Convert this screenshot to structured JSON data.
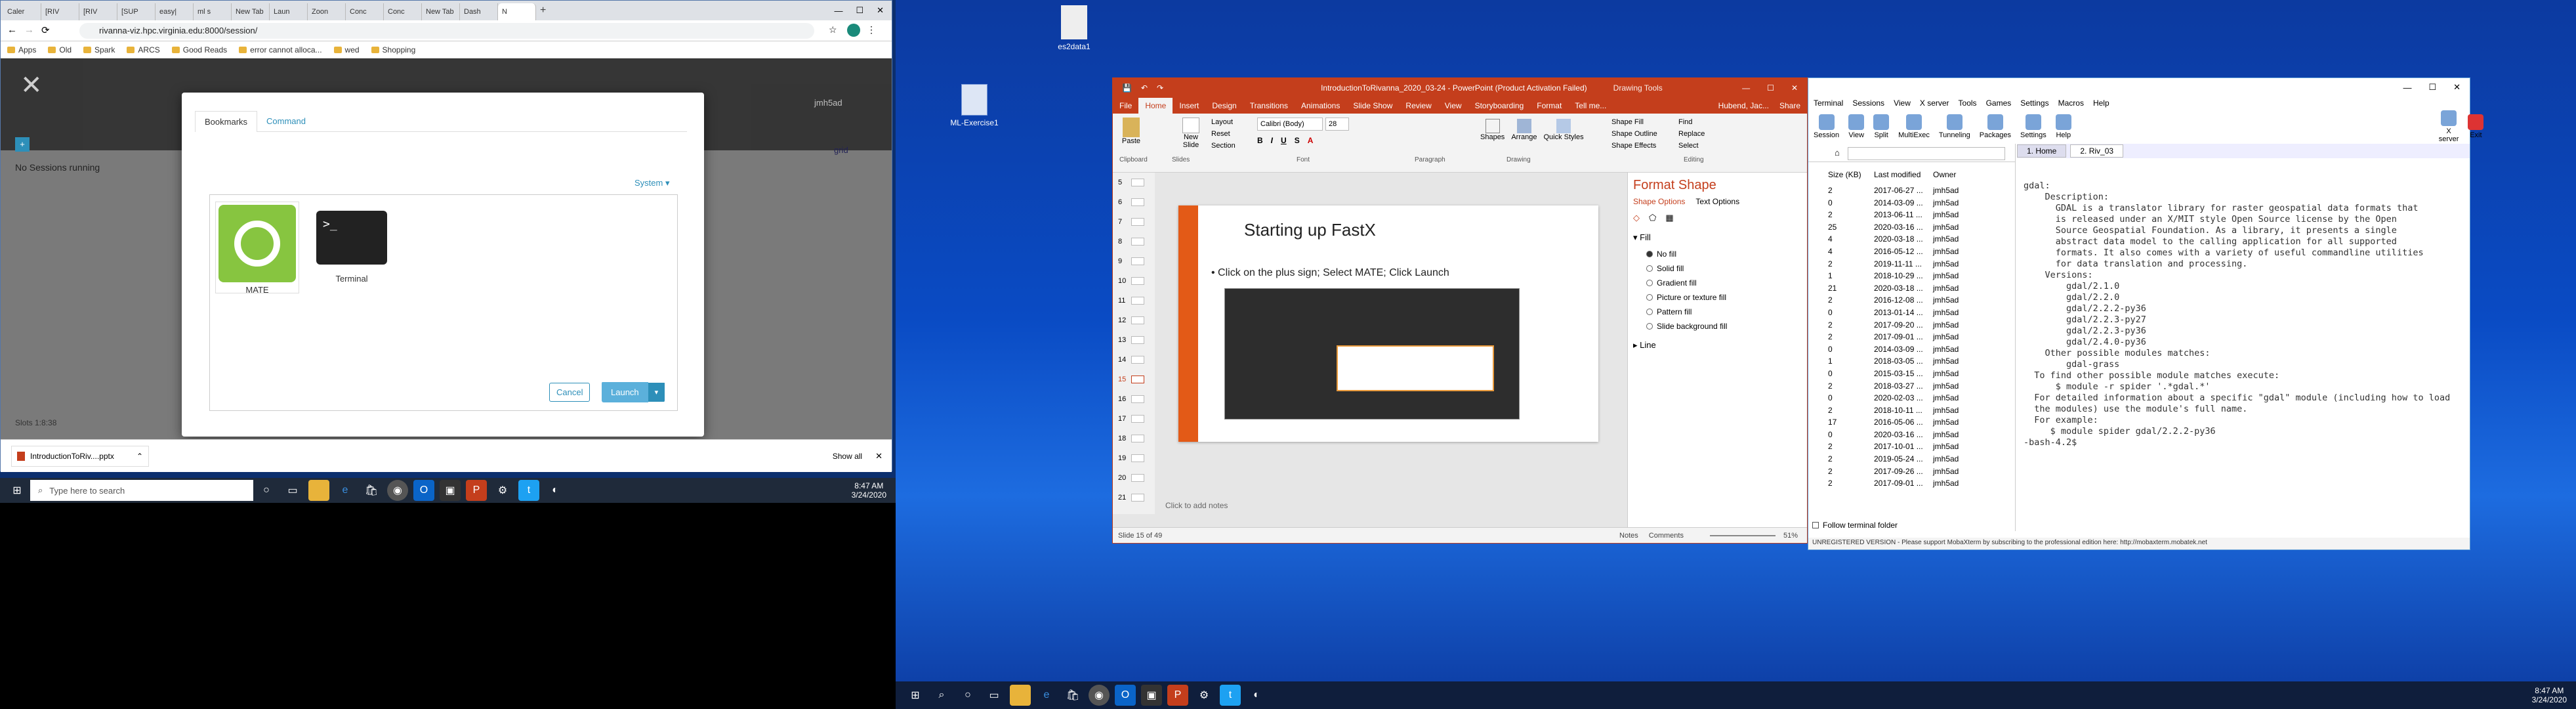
{
  "browser": {
    "tabs": [
      "Caler",
      "[RIV",
      "[RIV",
      "[SUP",
      "easy|",
      "ml s",
      "New Tab",
      "Laun",
      "Zoon",
      "Conc",
      "Conc",
      "New Tab",
      "Dash",
      "N"
    ],
    "url": "rivanna-viz.hpc.virginia.edu:8000/session/",
    "bookmarks": [
      "Apps",
      "Old",
      "Spark",
      "ARCS",
      "Good Reads",
      "error cannot alloca...",
      "wed",
      "Shopping"
    ],
    "page": {
      "user": "jmh5ad",
      "no_sessions": "No Sessions running",
      "grid": "grid",
      "footer_left": "Slots 1:8:38",
      "modal_tabs": [
        "Bookmarks",
        "Command"
      ],
      "system": "System",
      "apps": [
        {
          "label": "MATE"
        },
        {
          "label": "Terminal"
        }
      ],
      "cancel": "Cancel",
      "launch": "Launch"
    },
    "download": {
      "file": "IntroductionToRiv....pptx",
      "show_all": "Show all"
    }
  },
  "taskbar_left": {
    "search_placeholder": "Type here to search",
    "time": "8:47 AM",
    "date": "3/24/2020"
  },
  "desktop_icons": [
    "es2data1",
    "ML-Exercise1"
  ],
  "ppt": {
    "title": "IntroductionToRivanna_2020_03-24 - PowerPoint (Product Activation Failed)",
    "drawing_tools": "Drawing Tools",
    "user": "Hubend, Jac...",
    "share": "Share",
    "tell_me": "Tell me...",
    "tabs": [
      "File",
      "Home",
      "Insert",
      "Design",
      "Transitions",
      "Animations",
      "Slide Show",
      "Review",
      "View",
      "Storyboarding",
      "Format"
    ],
    "ribbon_groups": [
      "Clipboard",
      "Slides",
      "Font",
      "Paragraph",
      "Drawing",
      "Editing"
    ],
    "ribbon_labels": {
      "paste": "Paste",
      "new_slide": "New Slide",
      "layout": "Layout",
      "reset": "Reset",
      "section": "Section",
      "font": "Calibri (Body)",
      "size": "28",
      "shapes": "Shapes",
      "arrange": "Arrange",
      "quick_styles": "Quick Styles",
      "fill": "Shape Fill",
      "outline": "Shape Outline",
      "effects": "Shape Effects",
      "find": "Find",
      "replace": "Replace",
      "select": "Select"
    },
    "slide_numbers": [
      "5",
      "6",
      "7",
      "8",
      "9",
      "10",
      "11",
      "12",
      "13",
      "14",
      "15",
      "16",
      "17",
      "18",
      "19",
      "20",
      "21"
    ],
    "slide_title": "Starting up FastX",
    "bullet": "Click on the plus sign; Select MATE; Click Launch",
    "notes": "Click to add notes",
    "status_left": "Slide 15 of 49",
    "notes_btn": "Notes",
    "comments_btn": "Comments",
    "zoom": "51%",
    "format_pane": {
      "title": "Format Shape",
      "tabs": [
        "Shape Options",
        "Text Options"
      ],
      "fill": "Fill",
      "options": [
        "No fill",
        "Solid fill",
        "Gradient fill",
        "Picture or texture fill",
        "Pattern fill",
        "Slide background fill"
      ],
      "line": "Line"
    }
  },
  "moba": {
    "menu": [
      "Terminal",
      "Sessions",
      "View",
      "X server",
      "Tools",
      "Games",
      "Settings",
      "Macros",
      "Help"
    ],
    "toolbar": [
      "Session",
      "View",
      "Split",
      "MultiExec",
      "Tunneling",
      "Packages",
      "Settings",
      "Help",
      "X server",
      "Exit"
    ],
    "tabs": [
      "1. Home",
      "2. Riv_03"
    ],
    "columns": [
      "Size (KB)",
      "Last modified",
      "Owner"
    ],
    "files": [
      [
        "2",
        "2017-06-27 ...",
        "jmh5ad"
      ],
      [
        "0",
        "2014-03-09 ...",
        "jmh5ad"
      ],
      [
        "2",
        "2013-06-11 ...",
        "jmh5ad"
      ],
      [
        "25",
        "2020-03-16 ...",
        "jmh5ad"
      ],
      [
        "4",
        "2020-03-18 ...",
        "jmh5ad"
      ],
      [
        "4",
        "2016-05-12 ...",
        "jmh5ad"
      ],
      [
        "2",
        "2019-11-11 ...",
        "jmh5ad"
      ],
      [
        "1",
        "2018-10-29 ...",
        "jmh5ad"
      ],
      [
        "21",
        "2020-03-18 ...",
        "jmh5ad"
      ],
      [
        "2",
        "2016-12-08 ...",
        "jmh5ad"
      ],
      [
        "0",
        "2013-01-14 ...",
        "jmh5ad"
      ],
      [
        "2",
        "2017-09-20 ...",
        "jmh5ad"
      ],
      [
        "2",
        "2017-09-01 ...",
        "jmh5ad"
      ],
      [
        "0",
        "2014-03-09 ...",
        "jmh5ad"
      ],
      [
        "1",
        "2018-03-05 ...",
        "jmh5ad"
      ],
      [
        "0",
        "2015-03-15 ...",
        "jmh5ad"
      ],
      [
        "2",
        "2018-03-27 ...",
        "jmh5ad"
      ],
      [
        "0",
        "2020-02-03 ...",
        "jmh5ad"
      ],
      [
        "2",
        "2018-10-11 ...",
        "jmh5ad"
      ],
      [
        "17",
        "2016-05-06 ...",
        "jmh5ad"
      ],
      [
        "0",
        "2020-03-16 ...",
        "jmh5ad"
      ],
      [
        "2",
        "2017-10-01 ...",
        "jmh5ad"
      ],
      [
        "2",
        "2019-05-24 ...",
        "jmh5ad"
      ],
      [
        "2",
        "2017-09-26 ...",
        "jmh5ad"
      ],
      [
        "2",
        "2017-09-01 ...",
        "jmh5ad"
      ]
    ],
    "follow": "Follow terminal folder",
    "terminal_lines": [
      "gdal:",
      "",
      "    Description:",
      "      GDAL is a translator library for raster geospatial data formats that",
      "      is released under an X/MIT style Open Source license by the Open",
      "      Source Geospatial Foundation. As a library, it presents a single",
      "      abstract data model to the calling application for all supported",
      "      formats. It also comes with a variety of useful commandline utilities",
      "      for data translation and processing.",
      "",
      "    Versions:",
      "        gdal/2.1.0",
      "        gdal/2.2.0",
      "        gdal/2.2.2-py36",
      "        gdal/2.2.3-py27",
      "        gdal/2.2.3-py36",
      "        gdal/2.4.0-py36",
      "    Other possible modules matches:",
      "        gdal-grass",
      "",
      "",
      "  To find other possible module matches execute:",
      "",
      "      $ module -r spider '.*gdal.*'",
      "",
      "",
      "  For detailed information about a specific \"gdal\" module (including how to load",
      "  the modules) use the module's full name.",
      "  For example:",
      "",
      "     $ module spider gdal/2.2.2-py36",
      "",
      "",
      "",
      "-bash-4.2$ "
    ],
    "unregistered": "UNREGISTERED VERSION - Please support MobaXterm by subscribing to the professional edition here: http://mobaxterm.mobatek.net"
  },
  "taskbar_right": {
    "time": "8:47 AM",
    "date": "3/24/2020"
  }
}
